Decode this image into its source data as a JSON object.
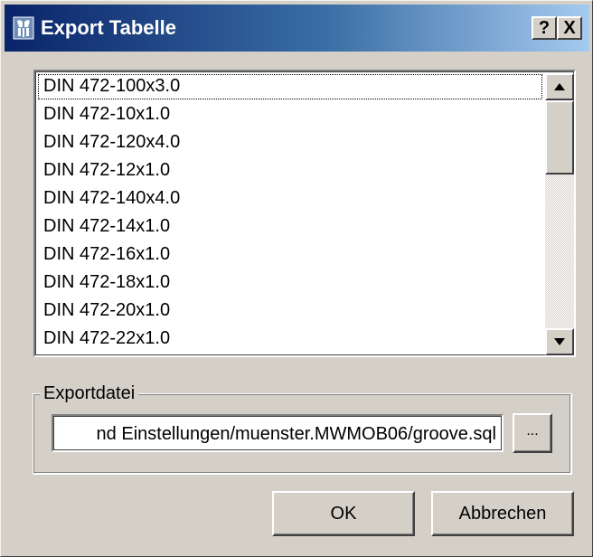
{
  "window": {
    "title": "Export Tabelle",
    "help_label": "?",
    "close_label": "X",
    "app_icon": "tool-icon",
    "colors": {
      "title_bar_start": "#0a246a",
      "title_bar_end": "#a6caf0",
      "face": "#d4d0c8"
    }
  },
  "table_list": {
    "items": [
      "DIN 472-100x3.0",
      "DIN 472-10x1.0",
      "DIN 472-120x4.0",
      "DIN 472-12x1.0",
      "DIN 472-140x4.0",
      "DIN 472-14x1.0",
      "DIN 472-16x1.0",
      "DIN 472-18x1.0",
      "DIN 472-20x1.0",
      "DIN 472-22x1.0"
    ],
    "focused_index": 0,
    "scroll_up_icon": "scroll-up-arrow-icon",
    "scroll_down_icon": "scroll-down-arrow-icon"
  },
  "export_group": {
    "label": "Exportdatei",
    "file_path": "nd Einstellungen/muenster.MWMOB06/groove.sql",
    "browse_label": "..."
  },
  "buttons": {
    "ok_label": "OK",
    "cancel_label": "Abbrechen"
  }
}
